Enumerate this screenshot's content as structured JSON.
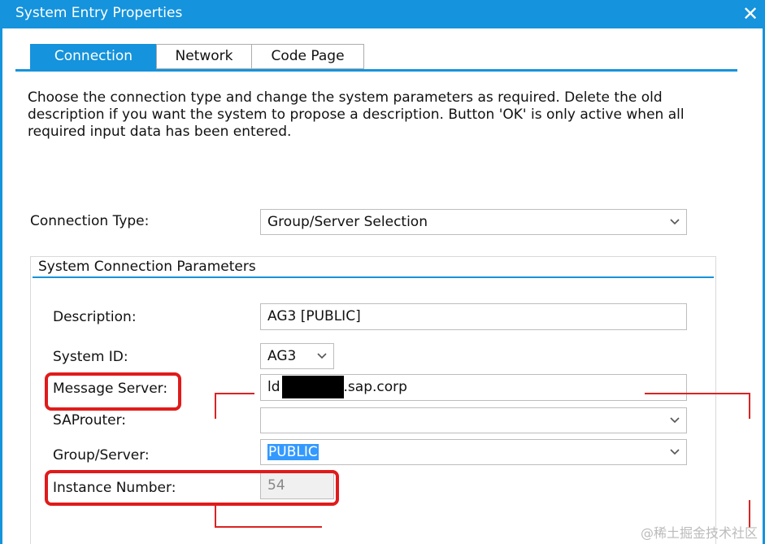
{
  "window": {
    "title": "System Entry Properties",
    "close_glyph": "✕"
  },
  "tabs": [
    {
      "label": "Connection",
      "active": true
    },
    {
      "label": "Network",
      "active": false
    },
    {
      "label": "Code Page",
      "active": false
    }
  ],
  "intro_text": "Choose the connection type and change the system parameters as required. Delete the old description if you want the system to propose a description. Button 'OK' is only active when all required input data has been entered.",
  "connection_type": {
    "label": "Connection Type:",
    "value": "Group/Server Selection"
  },
  "group": {
    "title": "System Connection Parameters",
    "description": {
      "label": "Description:",
      "value": "AG3 [PUBLIC]"
    },
    "system_id": {
      "label": "System ID:",
      "value": "AG3"
    },
    "message_server": {
      "label": "Message Server:",
      "value_prefix": "ld",
      "value_suffix": ".sap.corp"
    },
    "saprouter": {
      "label": "SAProuter:",
      "value": ""
    },
    "group_server": {
      "label": "Group/Server:",
      "value": "PUBLIC"
    },
    "instance_number": {
      "label": "Instance Number:",
      "value": "54"
    }
  },
  "watermark": "@稀土掘金技术社区",
  "colors": {
    "accent": "#1593dc",
    "annotation_red": "#e01b1b",
    "selection": "#3399ff"
  },
  "icons": {
    "dropdown": "chevron-down-icon",
    "close": "close-icon"
  }
}
